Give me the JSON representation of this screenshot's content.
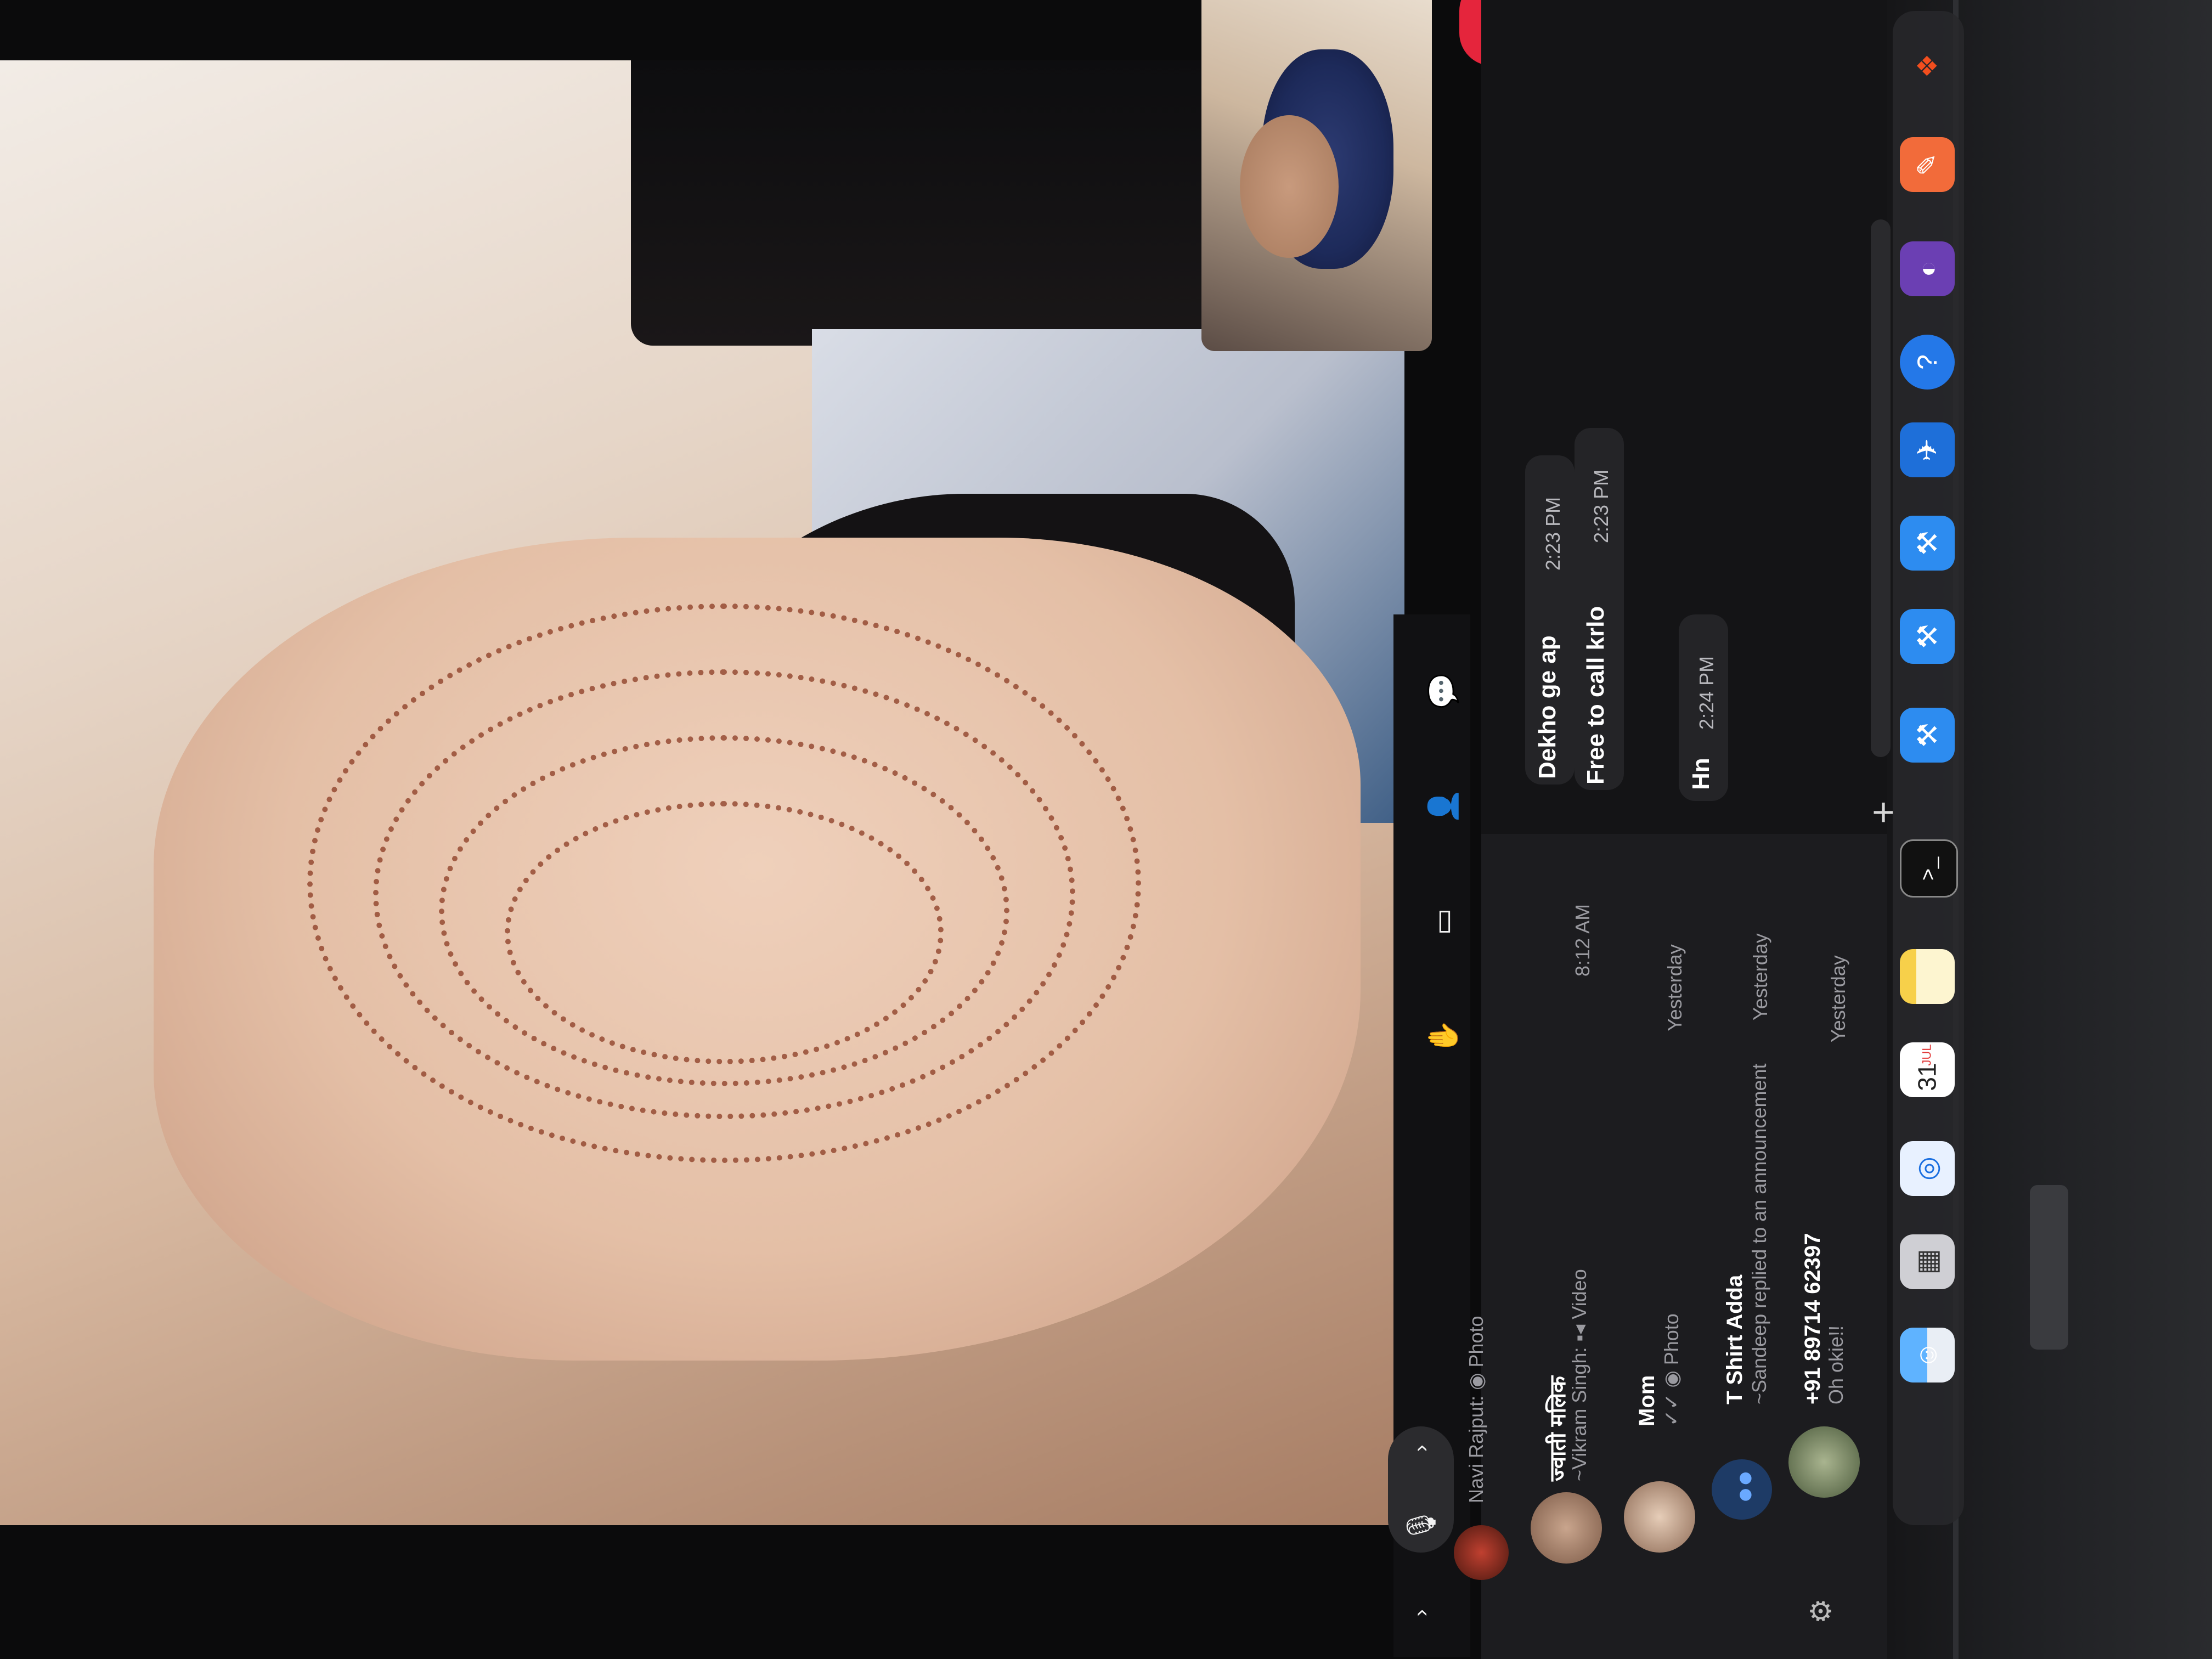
{
  "conversation": {
    "messages": [
      {
        "text": "Dekho ge ap",
        "time": "2:23 PM"
      },
      {
        "text": "Free to call krlo",
        "time": "2:23 PM"
      },
      {
        "text": "Hn",
        "time": "2:24 PM"
      }
    ],
    "compose": {
      "plus_icon": "+"
    }
  },
  "chats": [
    {
      "name": "",
      "preview": "Navi Rajput: ◉ Photo",
      "time": ""
    },
    {
      "name": "ज्वाती मलिक",
      "preview": "~Vikram Singh: ▪◂ Video",
      "time": "8:12 AM"
    },
    {
      "name": "Mom",
      "preview": "✓✓ ◉ Photo",
      "time": "Yesterday"
    },
    {
      "name": "T Shirt Adda",
      "preview": "~Sandeep replied to an announcement",
      "time": "Yesterday"
    },
    {
      "name": "+91 89714 62397",
      "preview": "Oh okie!!",
      "time": "Yesterday"
    }
  ],
  "calendar_icon": {
    "month": "JUL",
    "day": "31"
  },
  "dock": [
    "finder-icon",
    "launchpad-icon",
    "safari-icon",
    "calendar-icon",
    "notes-icon",
    "terminal-icon",
    "xcode-icon",
    "xcode-icon",
    "xcode-icon",
    "instruments-icon",
    "simulator-icon",
    "github-icon",
    "postman-icon",
    "figma-icon"
  ],
  "call_controls": [
    "raise-hand-icon",
    "share-screen-icon",
    "add-person-icon",
    "chat-bubble-icon",
    "mic-icon"
  ],
  "colors": {
    "end_call": "#e5253c",
    "panel_bg": "#141416",
    "bubble_bg": "#242427"
  }
}
